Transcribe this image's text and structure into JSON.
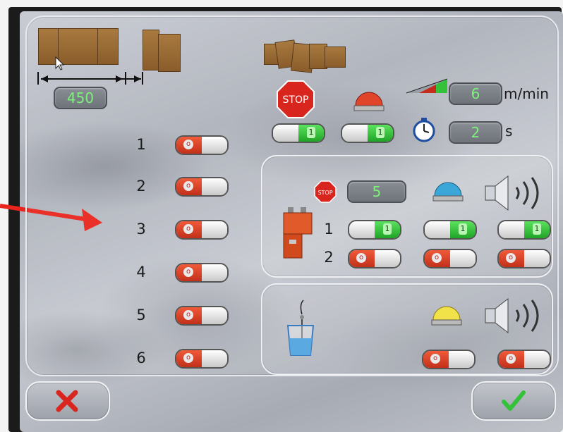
{
  "box_dimensions": {
    "length_value": "450"
  },
  "speed": {
    "value": "6",
    "unit": "m/min"
  },
  "delay": {
    "value": "2",
    "unit": "s"
  },
  "stop_label": "STOP",
  "stop_small_label": "STOP",
  "sensor_rows": [
    "1",
    "2",
    "3",
    "4",
    "5",
    "6"
  ],
  "sensor_toggles": [
    "off",
    "off",
    "off",
    "off",
    "off",
    "off"
  ],
  "top_toggles": {
    "stop": "on",
    "beacon": "on",
    "toggle_label": "1"
  },
  "glue_panel": {
    "count_value": "5",
    "rows": [
      "1",
      "2"
    ],
    "row1": {
      "stop": "on",
      "beacon": "on",
      "horn": "on"
    },
    "row2": {
      "stop": "off",
      "beacon": "off",
      "horn": "off"
    }
  },
  "tank_panel": {
    "beacon_toggle": "off",
    "horn_toggle": "off"
  },
  "footer": {
    "cancel_icon": "x-icon",
    "confirm_icon": "check-icon"
  },
  "colors": {
    "value_text": "#7df27b",
    "toggle_off": "#e0452a",
    "toggle_on": "#34c23a",
    "stop_red": "#d8261f",
    "beacon_blue": "#3ba6d8",
    "beacon_yellow": "#f2e24a"
  }
}
